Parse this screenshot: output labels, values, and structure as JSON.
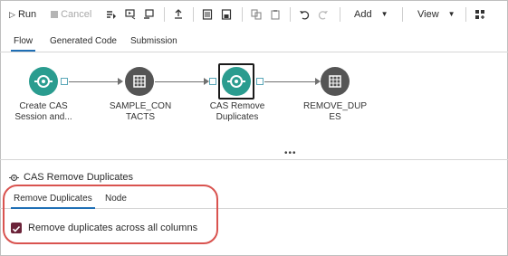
{
  "toolbar": {
    "run_label": "Run",
    "cancel_label": "Cancel",
    "add_label": "Add",
    "view_label": "View"
  },
  "tabs": [
    {
      "label": "Flow",
      "active": true
    },
    {
      "label": "Generated Code",
      "active": false
    },
    {
      "label": "Submission",
      "active": false
    }
  ],
  "flow": {
    "nodes": [
      {
        "label_line1": "Create CAS",
        "label_line2": "Session and...",
        "icon": "cas-session-icon",
        "color": "#2a9c8f"
      },
      {
        "label_line1": "SAMPLE_CON",
        "label_line2": "TACTS",
        "icon": "table-icon",
        "color": "#555555"
      },
      {
        "label_line1": "CAS Remove",
        "label_line2": "Duplicates",
        "icon": "cas-remove-duplicates-icon",
        "color": "#2a9c8f",
        "selected": true
      },
      {
        "label_line1": "REMOVE_DUP",
        "label_line2": "ES",
        "icon": "table-icon",
        "color": "#555555"
      }
    ]
  },
  "panel": {
    "title": "CAS Remove Duplicates",
    "tabs": [
      {
        "label": "Remove Duplicates",
        "active": true
      },
      {
        "label": "Node",
        "active": false
      }
    ],
    "option_label": "Remove duplicates across all columns",
    "option_checked": true
  },
  "colors": {
    "accent": "#1f6fb5",
    "checkbox": "#6b2339",
    "highlight": "#d9534f"
  }
}
